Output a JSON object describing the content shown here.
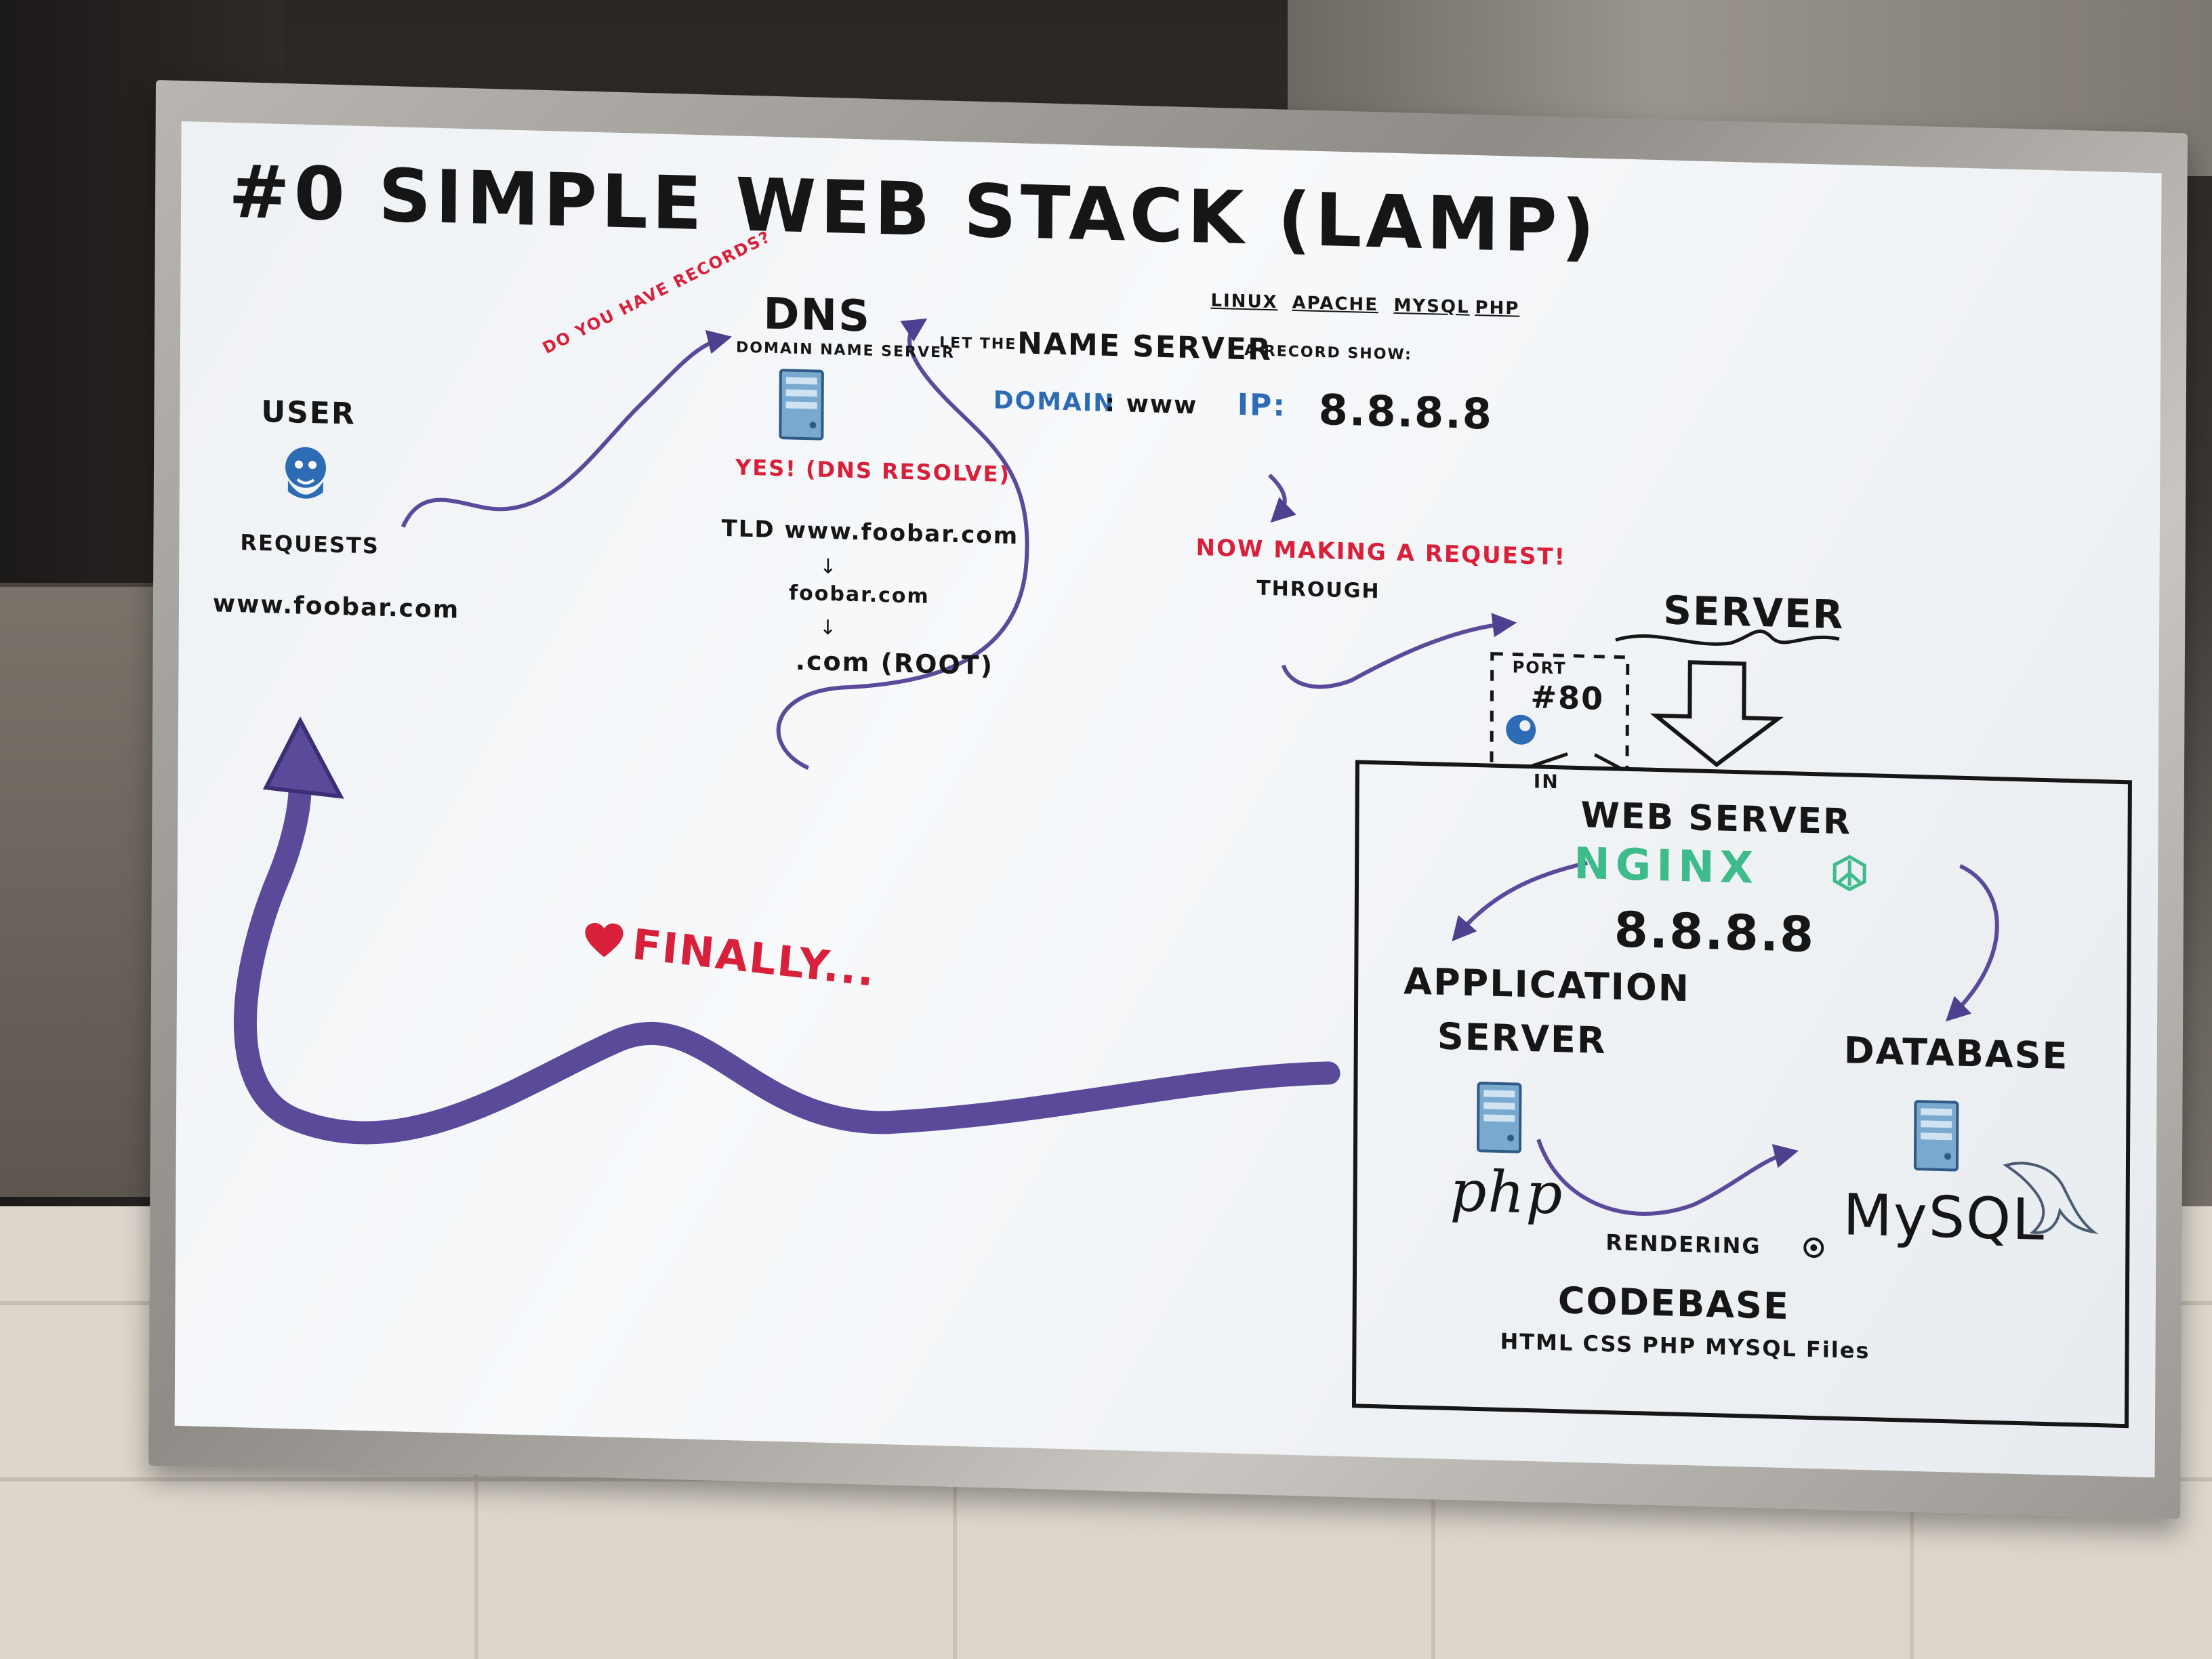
{
  "title": "#0 SIMPLE WEB STACK (LAMP)",
  "lamp_parts": [
    "LINUX",
    "APACHE",
    "MYSQL",
    "PHP"
  ],
  "user": {
    "label": "USER",
    "requests": "REQUESTS",
    "domain": "www.foobar.com"
  },
  "question": "DO YOU HAVE RECORDS?",
  "dns": {
    "label": "DNS",
    "sub": "DOMAIN NAME SERVER",
    "yes": "YES! (DNS RESOLVE)",
    "tld": "TLD www.foobar.com",
    "step2": "foobar.com",
    "root": ".com (ROOT)"
  },
  "record": {
    "intro_pre": "LET THE",
    "intro_name": "NAME SERVER",
    "intro_post": "A RECORD SHOW:",
    "domain_label": "DOMAIN",
    "domain_value": ": www",
    "ip_label": "IP:",
    "ip_value": "8.8.8.8"
  },
  "request": {
    "making": "NOW MAKING A REQUEST!",
    "through": "THROUGH",
    "port": "PORT",
    "port_num": "#80",
    "in": "IN"
  },
  "server_label": "SERVER",
  "web_server": {
    "label": "WEB SERVER",
    "nginx": "NGINX",
    "ip": "8.8.8.8"
  },
  "app_server": {
    "line1": "APPLICATION",
    "line2": "SERVER",
    "php": "php"
  },
  "database": {
    "label": "DATABASE",
    "mysql": "MySQL"
  },
  "rendering": "RENDERING",
  "codebase": {
    "label": "CODEBASE",
    "files": "HTML CSS PHP MYSQL Files"
  },
  "finally": "FINALLY...",
  "colors": {
    "ink": "#161616",
    "purple": "#5b4a9a",
    "red": "#d8203a",
    "blue": "#2e6bb5",
    "green": "#3dbb8a"
  },
  "icons": [
    "user-avatar-icon",
    "server-icon",
    "heart-icon",
    "cloud-icon",
    "dolphin-icon",
    "peace-icon"
  ]
}
